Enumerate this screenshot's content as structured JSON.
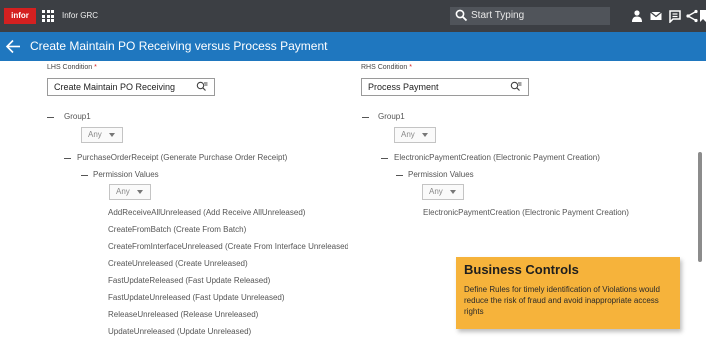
{
  "topbar": {
    "logo_text": "infor",
    "app_title": "Infor GRC",
    "search_placeholder": "Start Typing",
    "icons": [
      "apps-grid-icon",
      "search-icon",
      "user-icon",
      "mail-icon",
      "notes-icon",
      "share-icon",
      "bookmark-icon"
    ]
  },
  "header": {
    "title": "Create Maintain PO Receiving versus Process Payment",
    "back_icon": "arrow-left-icon"
  },
  "lhs": {
    "label": "LHS Condition",
    "required_mark": "*",
    "value": "Create Maintain PO Receiving",
    "group": "Group1",
    "group_operator": "Any",
    "node": "PurchaseOrderReceipt (Generate Purchase Order Receipt)",
    "permission_values_label": "Permission Values",
    "permission_operator": "Any",
    "permissions": [
      "AddReceiveAllUnreleased (Add Receive AllUnreleased)",
      "CreateFromBatch (Create From Batch)",
      "CreateFromInterfaceUnreleased (Create From Interface Unreleased)",
      "CreateUnreleased (Create Unreleased)",
      "FastUpdateReleased (Fast Update Released)",
      "FastUpdateUnreleased (Fast Update Unreleased)",
      "ReleaseUnreleased (Release Unreleased)",
      "UpdateUnreleased (Update Unreleased)"
    ]
  },
  "rhs": {
    "label": "RHS Condition",
    "required_mark": "*",
    "value": "Process Payment",
    "group": "Group1",
    "group_operator": "Any",
    "node": "ElectronicPaymentCreation (Electronic Payment Creation)",
    "permission_values_label": "Permission Values",
    "permission_operator": "Any",
    "permissions": [
      "ElectronicPaymentCreation (Electronic Payment Creation)"
    ]
  },
  "callout": {
    "title": "Business Controls",
    "body": "Define Rules for timely identification of Violations would reduce the risk of fraud and avoid inappropriate access rights"
  },
  "colors": {
    "topbar": "#3c3f44",
    "header": "#1f77bf",
    "logo": "#d42020",
    "callout": "#f6b33b"
  }
}
